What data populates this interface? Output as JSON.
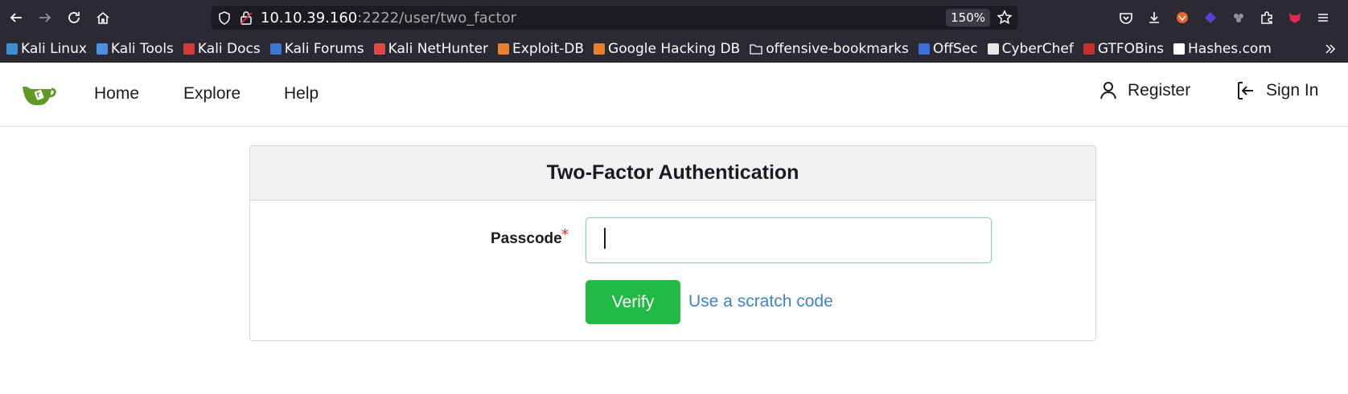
{
  "browser": {
    "url_host": "10.10.39.160",
    "url_rest": ":2222/user/two_factor",
    "zoom": "150%",
    "bookmarks": [
      {
        "label": "Kali Linux",
        "color": "#3d8fd1"
      },
      {
        "label": "Kali Tools",
        "color": "#4a8fe0"
      },
      {
        "label": "Kali Docs",
        "color": "#d23b3b"
      },
      {
        "label": "Kali Forums",
        "color": "#3b78d6"
      },
      {
        "label": "Kali NetHunter",
        "color": "#e04848"
      },
      {
        "label": "Exploit-DB",
        "color": "#e8802e"
      },
      {
        "label": "Google Hacking DB",
        "color": "#e8802e"
      },
      {
        "label": "offensive-bookmarks",
        "color": "folder"
      },
      {
        "label": "OffSec",
        "color": "#3d6fd8"
      },
      {
        "label": "CyberChef",
        "color": "#e8e8e8"
      },
      {
        "label": "GTFOBins",
        "color": "#c43030"
      },
      {
        "label": "Hashes.com",
        "color": "#ffffff"
      }
    ]
  },
  "nav": {
    "home": "Home",
    "explore": "Explore",
    "help": "Help",
    "register": "Register",
    "sign_in": "Sign In"
  },
  "card": {
    "title": "Two-Factor Authentication",
    "passcode_label": "Passcode",
    "required_mark": "*",
    "passcode_value": "",
    "verify_label": "Verify",
    "scratch_link": "Use a scratch code"
  },
  "colors": {
    "accent_green": "#21ba45",
    "link_blue": "#4183c4",
    "required_red": "#db2828"
  }
}
